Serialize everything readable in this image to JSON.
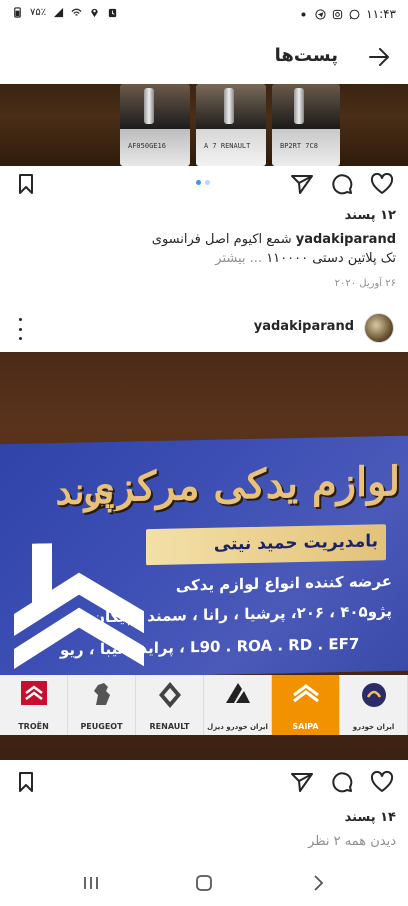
{
  "status_bar": {
    "time": "۱۱:۴۳",
    "battery": "۷۵٪",
    "icons_left": [
      "battery-icon",
      "signal-icon",
      "wifi-icon",
      "location-icon",
      "alarm-icon"
    ],
    "icons_right": [
      "dot-icon",
      "telegram-icon",
      "instagram-icon",
      "whatsapp-icon"
    ]
  },
  "header": {
    "title": "پست‌ها",
    "back_icon": "arrow-right-icon"
  },
  "post1": {
    "box_labels": [
      "AF050GE16",
      "A 7  RENAULT",
      "BP2RT 7C8"
    ],
    "likes": "۱۲ پسند",
    "caption_user": "yadakiparand",
    "caption_text": "شمع اکیوم اصل فرانسوی",
    "caption_line2": "تک پلاتین دستی ۱۱۰۰۰۰",
    "caption_more": "... بیشتر",
    "date": "۲۶ آوریل ۲۰۲۰",
    "carousel_dots": 2,
    "active_dot": 1
  },
  "post2": {
    "username": "yadakiparand",
    "card": {
      "title": "لوازم یدکی مرکزی",
      "brand": "پرند",
      "manager": "بامدیریت حمید نیتی",
      "line1": "عرضه کننده انواع لوازم یدکی",
      "line2": "پژو۴۰۵ ، ۲۰۶، پرشیا ، رانا ، سمند ، پیکان",
      "line3": "پراید ، تیبا ، ریو ، L90 . ROA . RD . EF7",
      "logos": [
        "TROËN",
        "PEUGEOT",
        "RENAULT",
        "ایران خودرو دیزل",
        "SAIPA",
        "ایران خودرو"
      ]
    },
    "likes": "۱۴ پسند",
    "view_comments": "دیدن همه ۲ نظر"
  },
  "colors": {
    "accent_blue": "#3897f0",
    "muted": "#8e8e8e",
    "text": "#262626"
  }
}
